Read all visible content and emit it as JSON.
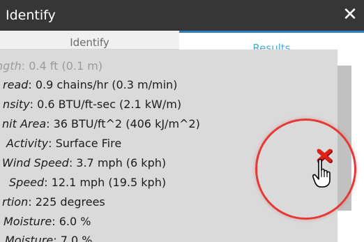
{
  "window": {
    "title": "Identify",
    "close_glyph": "✕",
    "close_icon": "close-icon"
  },
  "tabs": [
    {
      "label": "Identify",
      "active": false
    },
    {
      "label": "Results",
      "active": true
    }
  ],
  "results": {
    "rows": [
      {
        "label": "ngth",
        "value": ": 0.4 ft (0.1 m)"
      },
      {
        "label": "read",
        "value": ": 0.9 chains/hr (0.3 m/min)"
      },
      {
        "label": "nsity",
        "value": ": 0.6 BTU/ft-sec (2.1 kW/m)"
      },
      {
        "label": "nit Area",
        "value": ": 36 BTU/ft^2 (406 kJ/m^2)"
      },
      {
        "label": "Activity",
        "value": ": Surface Fire"
      },
      {
        "label": "Wind Speed",
        "value": ": 3.7 mph (6 kph)"
      },
      {
        "label": "Speed",
        "value": ": 12.1 mph (19.5 kph)"
      },
      {
        "label": "rtion",
        "value": ": 225 degrees"
      },
      {
        "label": "Moisture",
        "value": ": 6.0 %"
      },
      {
        "label": "Moisture",
        "value": ": 7.0 %"
      }
    ]
  },
  "overlay": {
    "clear_icon": "red-x-delete-icon",
    "cursor_icon": "hand-pointer-icon",
    "highlight_color": "#e53935"
  },
  "colors": {
    "titlebar": "#363636",
    "active_tab_text": "#48a9d8",
    "active_tab_border": "#2c7fb8",
    "results_bg": "#dadada"
  }
}
